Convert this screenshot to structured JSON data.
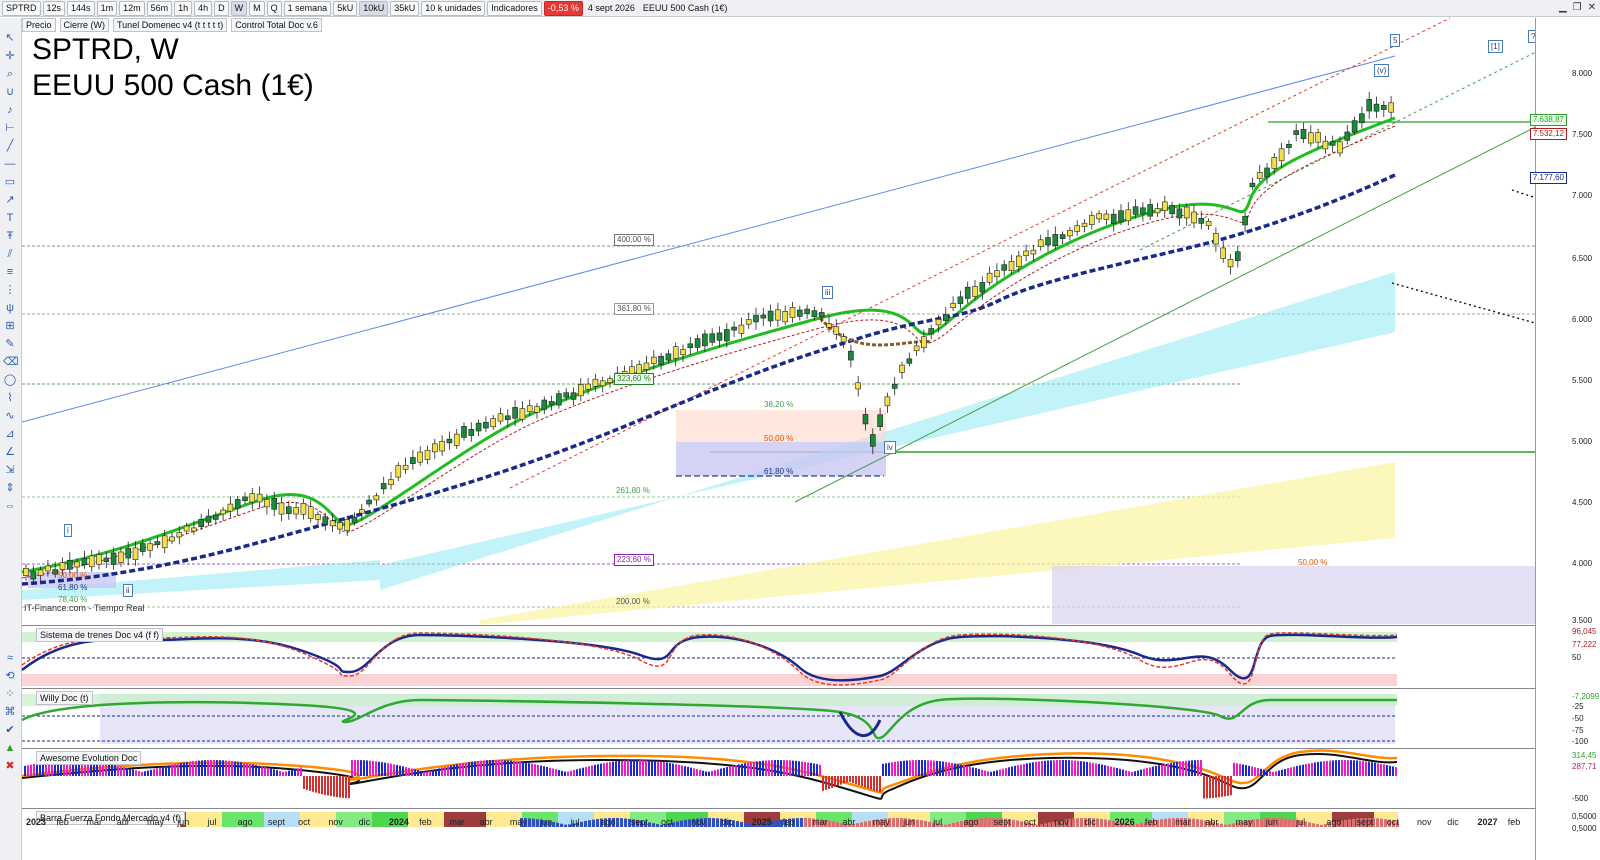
{
  "toolbar": {
    "symbol": "SPTRD",
    "intervals": [
      "12s",
      "144s",
      "1m",
      "12m",
      "56m",
      "1h",
      "4h",
      "D",
      "W",
      "M",
      "Q"
    ],
    "active_interval": "W",
    "range": "1 semana",
    "units": [
      "5kU",
      "10kU",
      "35kU"
    ],
    "active_unit": "10kU",
    "unit_select": "10 k unidades",
    "indicators": "Indicadores",
    "change": "-0,53 %",
    "date": "4 sept 2026",
    "instrument": "EEUU 500 Cash (1€)"
  },
  "legend": [
    "Precio",
    "Cierre (W)",
    "Tunel Domenec v4 (t t t t t)",
    "Control Total Doc v.6"
  ],
  "title": {
    "line1": "SPTRD, W",
    "line2": "EEUU 500 Cash (1€)"
  },
  "source": "IT-Finance.com - Tiempo Real",
  "price_scale": [
    "8.000",
    "7.500",
    "7.000",
    "6.500",
    "6.000",
    "5.500",
    "5.000",
    "4.500",
    "4.000",
    "3.500"
  ],
  "price_boxes": [
    {
      "text": "7.638,87",
      "color": "#2e9e2e"
    },
    {
      "text": "7.532,12",
      "color": "#b02020"
    },
    {
      "text": "7.177,60",
      "color": "#1a2a8a"
    }
  ],
  "fib_levels": [
    {
      "text": "400,00 %",
      "color": "#555555"
    },
    {
      "text": "361,80 %",
      "color": "#555555"
    },
    {
      "text": "323,60 %",
      "color": "#2e7d32"
    },
    {
      "text": "261,80 %",
      "color": "#43a047"
    },
    {
      "text": "223,60 %",
      "color": "#8e24aa"
    },
    {
      "text": "200,00 %",
      "color": "#555555"
    },
    {
      "text": "38,20 %",
      "color": "#43a047"
    },
    {
      "text": "50,00 %",
      "color": "#e65100"
    },
    {
      "text": "61,80 %",
      "color": "#1e3a8a"
    },
    {
      "text": "50,00 %",
      "color": "#e65100"
    },
    {
      "text": "61,80 %",
      "color": "#1e3a8a"
    },
    {
      "text": "78,40 %",
      "color": "#43a047"
    },
    {
      "text": "50,00 %",
      "color": "#e65100"
    }
  ],
  "waves": [
    "i",
    "ii",
    "iii",
    "iv",
    "(v)",
    "5",
    "[1]",
    "?"
  ],
  "panels": [
    {
      "name": "Sistema de trenes Doc v4 (f f)",
      "scale": [
        "96,045",
        "77,222",
        "50"
      ]
    },
    {
      "name": "Willy Doc (t)",
      "scale": [
        "-7,2099",
        "-25",
        "-50",
        "-75",
        "-100"
      ]
    },
    {
      "name": "Awesome Evolution Doc",
      "scale": [
        "314,45",
        "287,71",
        "-500"
      ]
    },
    {
      "name": "Barra Fuerza Fondo Mercado v4 (f)",
      "scale": [
        "0,5000",
        "0,5000"
      ]
    }
  ],
  "time_axis": [
    "2023",
    "feb",
    "mar",
    "abr",
    "may",
    "jun",
    "jul",
    "ago",
    "sept",
    "oct",
    "nov",
    "dic",
    "2024",
    "feb",
    "mar",
    "abr",
    "may",
    "jun",
    "jul",
    "ago",
    "sept",
    "oct",
    "nov",
    "dic",
    "2025",
    "feb",
    "mar",
    "abr",
    "may",
    "jun",
    "jul",
    "ago",
    "sept",
    "oct",
    "nov",
    "dic",
    "2026",
    "feb",
    "mar",
    "abr",
    "may",
    "jun",
    "jul",
    "ago",
    "sept",
    "oct",
    "nov",
    "dic",
    "2027",
    "feb"
  ],
  "colors": {
    "bull": "#f2e04a",
    "bear": "#1a8a3a",
    "ema_fast": "#22bb22",
    "ema_slow": "#1a2a8a",
    "accent_red": "#e53935"
  }
}
